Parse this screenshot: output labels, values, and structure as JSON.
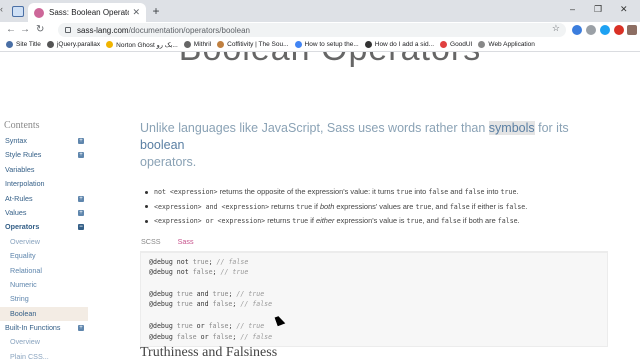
{
  "browser": {
    "tab_title": "Sass: Boolean Operators",
    "url_host": "sass-lang.com",
    "url_path": "/documentation/operators/boolean",
    "bookmarks": [
      {
        "label": "Site Title",
        "color": "#4a6fa5"
      },
      {
        "label": "jQuery.parallax",
        "color": "#555555"
      },
      {
        "label": "Norton Ghost بک رو...",
        "color": "#f0b400"
      },
      {
        "label": "Mithril",
        "color": "#666666"
      },
      {
        "label": "Coffitivity | The Sou...",
        "color": "#c08040"
      },
      {
        "label": "How to setup the...",
        "color": "#4285f4"
      },
      {
        "label": "How do I add a sid...",
        "color": "#333333"
      },
      {
        "label": "GoodUI",
        "color": "#e04040"
      },
      {
        "label": "Web Application",
        "color": "#888888"
      }
    ]
  },
  "hero_title": "Boolean Operators",
  "sidebar": {
    "heading": "Contents",
    "items": [
      {
        "label": "Syntax",
        "expand": "+"
      },
      {
        "label": "Style Rules",
        "expand": "+"
      },
      {
        "label": "Variables",
        "expand": ""
      },
      {
        "label": "Interpolation",
        "expand": ""
      },
      {
        "label": "At-Rules",
        "expand": "+"
      },
      {
        "label": "Values",
        "expand": "+"
      },
      {
        "label": "Operators",
        "expand": "−"
      },
      {
        "label": "Overview",
        "expand": ""
      },
      {
        "label": "Equality",
        "expand": ""
      },
      {
        "label": "Relational",
        "expand": ""
      },
      {
        "label": "Numeric",
        "expand": ""
      },
      {
        "label": "String",
        "expand": ""
      },
      {
        "label": "Boolean",
        "expand": ""
      },
      {
        "label": "Built-In Functions",
        "expand": "+"
      },
      {
        "label": "Overview",
        "expand": ""
      },
      {
        "label": "Plain CSS...",
        "expand": ""
      }
    ]
  },
  "intro": {
    "part1": "Unlike languages like JavaScript, Sass uses words rather than ",
    "symbols": "symbols",
    "part2": " for its ",
    "boolean": "boolean",
    "part3": "operators."
  },
  "bullets": {
    "b1": {
      "code": "not <expression>",
      "t1": " returns the opposite of the expression's value: it turns ",
      "c1": "true",
      "t2": " into ",
      "c2": "false",
      "t3": " and ",
      "c3": "false",
      "t4": " into ",
      "c4": "true",
      "t5": "."
    },
    "b2": {
      "code": "<expression> and <expression>",
      "t1": " returns ",
      "c1": "true",
      "t2": " if ",
      "e1": "both",
      "t3": " expressions' values are ",
      "c2": "true",
      "t4": ", and ",
      "c3": "false",
      "t5": " if either is ",
      "c4": "false",
      "t6": "."
    },
    "b3": {
      "code": "<expression> or <expression>",
      "t1": " returns ",
      "c1": "true",
      "t2": " if ",
      "e1": "either",
      "t3": " expression's value is ",
      "c2": "true",
      "t4": ", and ",
      "c3": "false",
      "t5": " if both are ",
      "c4": "false",
      "t6": "."
    }
  },
  "code_tabs": {
    "scss": "SCSS",
    "sass": "Sass"
  },
  "code": {
    "l1": {
      "kw": "@debug ",
      "op": "not ",
      "val": "true",
      "end": "; ",
      "cm": "// false"
    },
    "l2": {
      "kw": "@debug ",
      "op": "not ",
      "val": "false",
      "end": "; ",
      "cm": "// true"
    },
    "l3": {
      "kw": "@debug ",
      "a": "true",
      "op": " and ",
      "b": "true",
      "end": "; ",
      "cm": "// true"
    },
    "l4": {
      "kw": "@debug ",
      "a": "true",
      "op": " and ",
      "b": "false",
      "end": "; ",
      "cm": "// false"
    },
    "l5": {
      "kw": "@debug ",
      "a": "true",
      "op": " or ",
      "b": "false",
      "end": "; ",
      "cm": "// true"
    },
    "l6": {
      "kw": "@debug ",
      "a": "false",
      "op": " or ",
      "b": "false",
      "end": "; ",
      "cm": "// false"
    }
  },
  "next_heading": "Truthiness and Falsiness"
}
